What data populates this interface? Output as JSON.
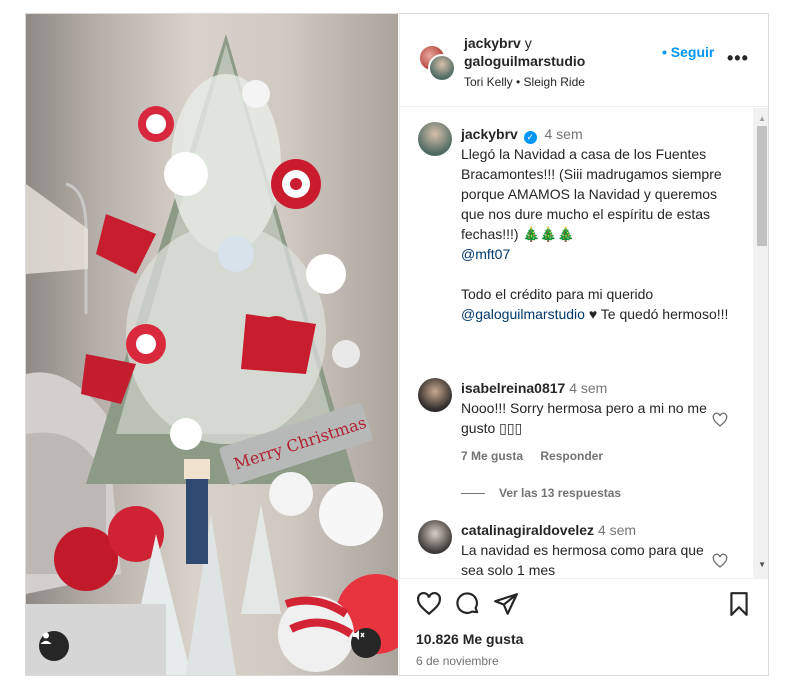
{
  "post": {
    "header": {
      "user1": "jackybrv",
      "connector": "y",
      "user2": "galoguilmarstudio",
      "follow_label": "• Seguir",
      "more_label": "•••",
      "audio": "Tori Kelly • Sleigh Ride"
    },
    "caption": {
      "username": "jackybrv",
      "time": "4 sem",
      "line1": "Llegó la Navidad a casa de los Fuentes Bracamontes!!! (Siii madrugamos siempre porque AMAMOS la Navidad y queremos que nos dure mucho el espíritu de estas fechas!!!) 🎄🎄🎄",
      "mention1": "@mft07",
      "line2a": "Todo el crédito para mi querido",
      "mention2": "@galoguilmarstudio",
      "line2b": "♥ Te quedó hermoso!!!"
    },
    "comments": [
      {
        "username": "isabelreina0817",
        "time": "4 sem",
        "text": "Nooo!!! Sorry hermosa pero a mi no me gusto ▯▯▯",
        "likes": "7 Me gusta",
        "reply": "Responder",
        "view_replies": "Ver las 13 respuestas"
      },
      {
        "username": "catalinagiraldovelez",
        "time": "4 sem",
        "text": "La navidad es hermosa como para que sea solo 1 mes"
      }
    ],
    "likes": "10.826 Me gusta",
    "date": "6 de noviembre",
    "colors": {
      "accent": "#0095f6",
      "text": "#262626",
      "secondary": "#737373"
    },
    "icons": [
      "heart-icon",
      "comment-icon",
      "share-icon",
      "bookmark-icon",
      "user-tag-icon",
      "speaker-muted-icon",
      "verified-badge-icon",
      "more-icon"
    ]
  }
}
